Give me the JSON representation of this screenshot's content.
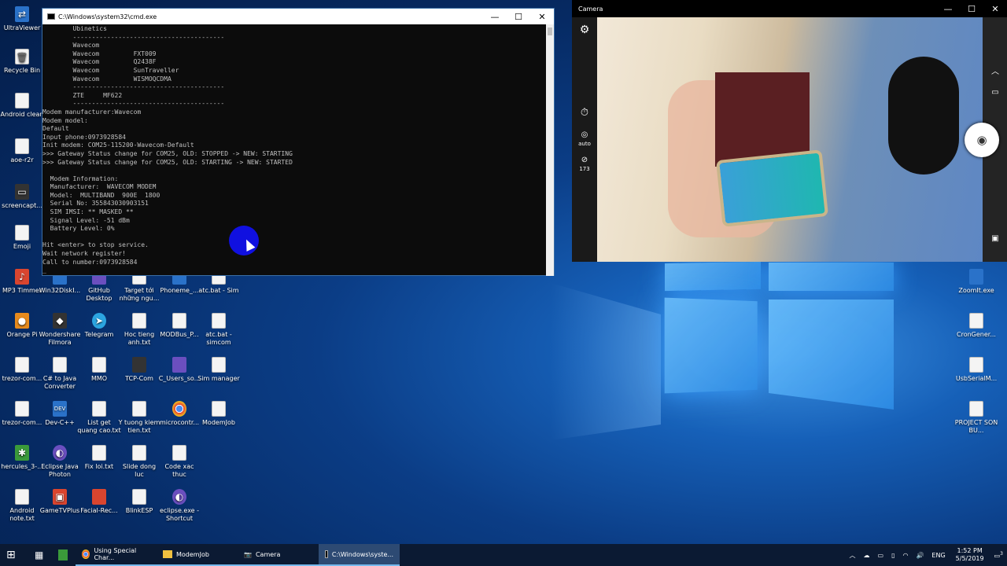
{
  "desktop": {
    "left_icons": [
      "UltraViewer",
      "Recycle Bin",
      "Android clean",
      "aoe-r2r",
      "screencapt...",
      "Emoji",
      "MP3 Timmer",
      "Orange Pi",
      "trezor-com...",
      "trezor-com...",
      "hercules_3-...",
      "Android note.txt"
    ],
    "grid_icons": [
      [
        "Win32DiskI...",
        "GitHub Desktop",
        "Target tới những ngu...",
        "Phoneme_...",
        "atc.bat - Sim"
      ],
      [
        "Wondershare Filmora",
        "Telegram",
        "Hoc tieng anh.txt",
        "MODBus_P...",
        "atc.bat - simcom"
      ],
      [
        "C# to Java Converter",
        "MMO",
        "TCP-Com",
        "C_Users_so...",
        "Sim manager"
      ],
      [
        "Dev-C++",
        "List get quang cao.txt",
        "Y tuong kiem tien.txt",
        "microcontr...",
        "ModemJob"
      ],
      [
        "Eclipse Java Photon",
        "Fix loi.txt",
        "Slide dong luc",
        "Code xac thuc",
        ""
      ],
      [
        "GameTVPlus",
        "Facial-Rec...",
        "BlinkESP",
        "eclipse.exe - Shortcut",
        ""
      ]
    ],
    "right_icons": [
      "ZoomIt.exe",
      "CronGener...",
      "UsbSerialM...",
      "PROJECT SON BU..."
    ]
  },
  "cmd": {
    "title": "C:\\Windows\\system32\\cmd.exe",
    "lines": [
      "        Ubinetics",
      "        ----------------------------------------",
      "        Wavecom",
      "        Wavecom         FXT009",
      "        Wavecom         Q2438F",
      "        Wavecom         SunTraveller",
      "        Wavecom         WISMOQCDMA",
      "        ----------------------------------------",
      "        ZTE     MF622",
      "        ----------------------------------------",
      "Modem manufacturer:Wavecom",
      "Modem model:",
      "Default",
      "Input phone:0973928584",
      "Init modem: COM25-115200-Wavecom-Default",
      ">>> Gateway Status change for COM25, OLD: STOPPED -> NEW: STARTING",
      ">>> Gateway Status change for COM25, OLD: STARTING -> NEW: STARTED",
      "",
      "  Modem Information:",
      "  Manufacturer:  WAVECOM MODEM",
      "  Model:  MULTIBAND  900E  1800",
      "  Serial No: 355843030903151",
      "  SIM IMSI: ** MASKED **",
      "  Signal Level: -51 dBm",
      "  Battery Level: 0%",
      "",
      "Hit <enter> to stop service.",
      "Wait network register!",
      "Call to number:0973928584",
      "_"
    ]
  },
  "camera": {
    "title": "Camera",
    "timer_label": "auto",
    "count_label": "173"
  },
  "taskbar": {
    "apps": [
      "Using Special Char...",
      "ModemJob",
      "Camera",
      "C:\\Windows\\syste..."
    ],
    "lang": "ENG",
    "time": "1:52 PM",
    "date": "5/5/2019",
    "notif_count": "3"
  }
}
